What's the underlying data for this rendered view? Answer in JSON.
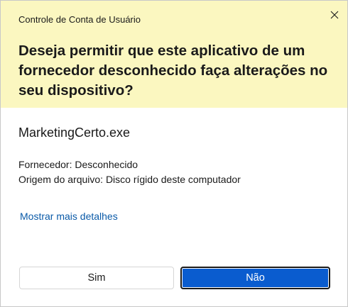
{
  "window": {
    "title": "Controle de Conta de Usuário"
  },
  "prompt": {
    "question": "Deseja permitir que este aplicativo de um fornecedor desconhecido faça alterações no seu dispositivo?"
  },
  "app": {
    "name": "MarketingCerto.exe",
    "publisher": "Fornecedor: Desconhecido",
    "origin": "Origem do arquivo: Disco rígido deste computador"
  },
  "details_link": "Mostrar mais detalhes",
  "buttons": {
    "yes_label": "Sim",
    "no_label": "Não"
  },
  "icons": {
    "close": "close-icon"
  },
  "colors": {
    "header_background": "#fbf7c0",
    "link": "#0a5aa8",
    "primary_button": "#0a5ccf"
  }
}
